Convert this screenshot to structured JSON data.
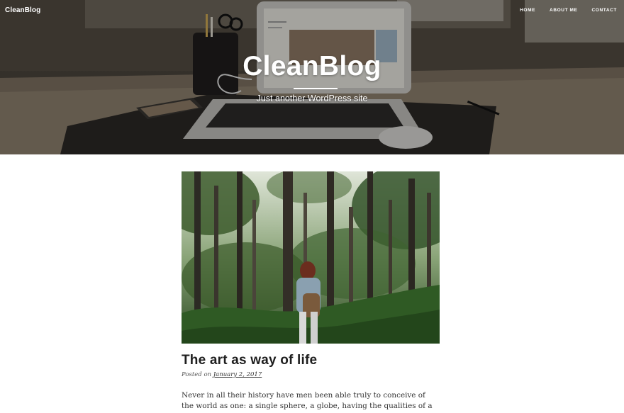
{
  "header": {
    "brand": "CleanBlog",
    "nav": [
      {
        "label": "HOME"
      },
      {
        "label": "ABOUT ME"
      },
      {
        "label": "CONTACT"
      }
    ],
    "site_title": "CleanBlog",
    "tagline": "Just another WordPress site"
  },
  "post": {
    "title": "The art as way of life",
    "posted_on_label": "Posted on",
    "date": "January 2, 2017",
    "excerpt": "Never in all their history have men been able truly to conceive of the world as one: a single sphere, a globe, having the qualities of a globe, a round earth in"
  }
}
